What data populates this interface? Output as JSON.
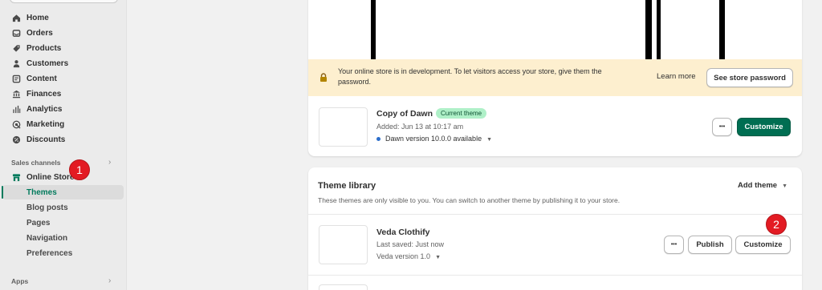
{
  "sidebar": {
    "nav": [
      {
        "label": "Home",
        "icon": "home-icon"
      },
      {
        "label": "Orders",
        "icon": "inbox-icon"
      },
      {
        "label": "Products",
        "icon": "tag-icon"
      },
      {
        "label": "Customers",
        "icon": "person-icon"
      },
      {
        "label": "Content",
        "icon": "content-icon"
      },
      {
        "label": "Finances",
        "icon": "bank-icon"
      },
      {
        "label": "Analytics",
        "icon": "bar-chart-icon"
      },
      {
        "label": "Marketing",
        "icon": "target-icon"
      },
      {
        "label": "Discounts",
        "icon": "discount-icon"
      }
    ],
    "sales_channels_label": "Sales channels",
    "online_store_label": "Online Store",
    "sub_items": [
      "Themes",
      "Blog posts",
      "Pages",
      "Navigation",
      "Preferences"
    ],
    "apps_label": "Apps"
  },
  "annotations": {
    "step1": "1",
    "step2": "2",
    "color": "#e31b23"
  },
  "banner": {
    "message": "Your online store is in development. To let visitors access your store, give them the password.",
    "learn_more": "Learn more",
    "see_password": "See store password"
  },
  "current_theme": {
    "name": "Copy of Dawn",
    "badge": "Current theme",
    "added": "Added: Jun 13 at 10:17 am",
    "version": "Dawn version 10.0.0 available",
    "more": "•••",
    "customize": "Customize"
  },
  "library": {
    "title": "Theme library",
    "subtitle": "These themes are only visible to you. You can switch to another theme by publishing it to your store.",
    "add_theme": "Add theme",
    "themes": [
      {
        "name": "Veda Clothify",
        "saved": "Last saved: Just now",
        "version": "Veda version 1.0",
        "more": "•••",
        "publish": "Publish",
        "customize": "Customize"
      }
    ]
  },
  "colors": {
    "accent": "#006e52",
    "banner_bg": "#fdefcf",
    "badge_bg": "#aff0c8"
  }
}
